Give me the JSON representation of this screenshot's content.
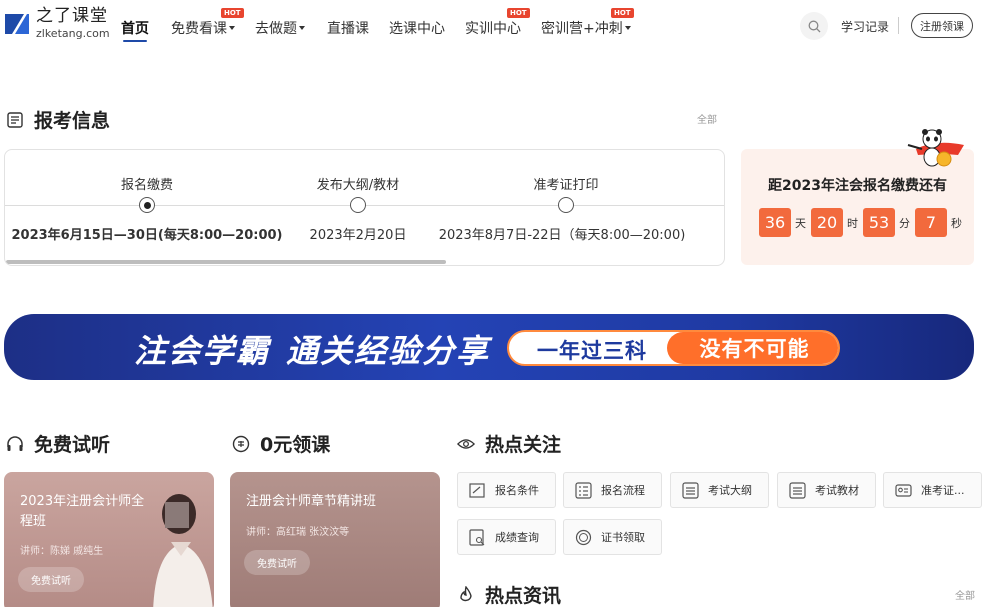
{
  "nav": {
    "logo_cn": "之了课堂",
    "logo_en": "zlketang.com",
    "items": [
      {
        "label": "首页",
        "active": true,
        "caret": false,
        "hot": false
      },
      {
        "label": "免费看课",
        "caret": true,
        "hot": true
      },
      {
        "label": "去做题",
        "caret": true,
        "hot": false
      },
      {
        "label": "直播课",
        "caret": false,
        "hot": false
      },
      {
        "label": "选课中心",
        "caret": false,
        "hot": false
      },
      {
        "label": "实训中心",
        "caret": false,
        "hot": true
      },
      {
        "label": "密训营+冲刺",
        "caret": true,
        "hot": true
      }
    ],
    "hot_badge": "HOT",
    "study_record": "学习记录",
    "register_button": "注册领课"
  },
  "exam_info": {
    "title": "报考信息",
    "more": "全部",
    "steps": [
      {
        "label": "报名缴费",
        "date": "2023年6月15日—30日(每天8:00—20:00)",
        "done": true
      },
      {
        "label": "发布大纲/教材",
        "date": "2023年2月20日",
        "done": false
      },
      {
        "label": "准考证打印",
        "date": "2023年8月7日-22日（每天8:00—20:00)",
        "done": false
      }
    ]
  },
  "countdown": {
    "title": "距2023年注会报名缴费还有",
    "days": "36",
    "days_unit": "天",
    "hours": "20",
    "hours_unit": "时",
    "minutes": "53",
    "minutes_unit": "分",
    "seconds": "7",
    "seconds_unit": "秒"
  },
  "banner": {
    "text1": "注会学霸",
    "text2": "通关经验分享",
    "pill_left": "一年过三科",
    "pill_right": "没有不可能"
  },
  "free_trial": {
    "title": "免费试听",
    "card": {
      "title": "2023年注册会计师全程班",
      "teacher": "讲师：陈娣 戚纯生",
      "button": "免费试听"
    }
  },
  "zero_yuan": {
    "title": "0元领课",
    "card": {
      "title": "注册会计师章节精讲班",
      "teacher": "讲师：高红瑞 张汶汶等",
      "button": "免费试听"
    }
  },
  "hot_focus": {
    "title": "热点关注",
    "items": [
      "报名条件",
      "报名流程",
      "考试大纲",
      "考试教材",
      "准考证...",
      "成绩查询",
      "证书领取"
    ]
  },
  "hot_news": {
    "title": "热点资讯",
    "more": "全部"
  },
  "colors": {
    "accent_orange": "#f26a3d",
    "brand_blue": "#1e4aa8",
    "hot_red": "#e8452f"
  }
}
